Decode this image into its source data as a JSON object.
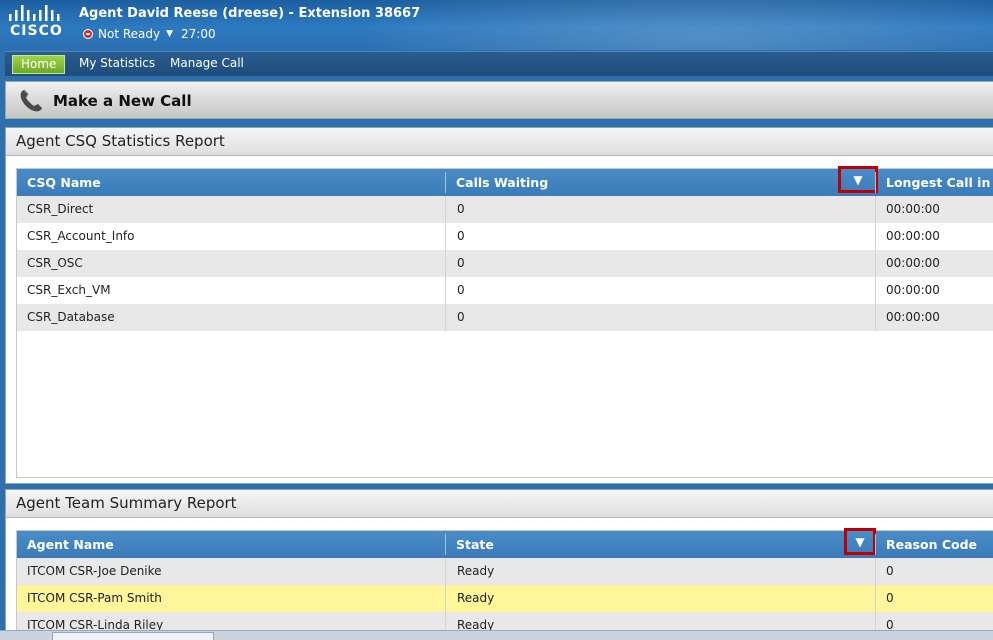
{
  "header": {
    "logo_text": "CISCO",
    "agent_title": "Agent David Reese (dreese) - Extension 38667",
    "status": "Not Ready",
    "timer": "27:00"
  },
  "nav": {
    "items": [
      "Home",
      "My Statistics",
      "Manage Call"
    ],
    "active": "Home"
  },
  "make_call": {
    "label": "Make a New Call"
  },
  "csq_report": {
    "title": "Agent CSQ Statistics Report",
    "columns": [
      "CSQ Name",
      "Calls Waiting",
      "Longest Call in Queue"
    ],
    "sort_glyph": "▼",
    "rows": [
      [
        "CSR_Direct",
        "0",
        "00:00:00"
      ],
      [
        "CSR_Account_Info",
        "0",
        "00:00:00"
      ],
      [
        "CSR_OSC",
        "0",
        "00:00:00"
      ],
      [
        "CSR_Exch_VM",
        "0",
        "00:00:00"
      ],
      [
        "CSR_Database",
        "0",
        "00:00:00"
      ]
    ]
  },
  "team_report": {
    "title": "Agent Team Summary Report",
    "columns": [
      "Agent Name",
      "State",
      "Reason Code"
    ],
    "sort_glyph": "▼",
    "rows": [
      [
        "ITCOM CSR-Joe Denike",
        "Ready",
        "0"
      ],
      [
        "ITCOM CSR-Pam Smith",
        "Ready",
        "0"
      ],
      [
        "ITCOM CSR-Linda Riley",
        "Ready",
        "0"
      ]
    ]
  },
  "colors": {
    "header_blue": "#2d7ac0",
    "grid_header": "#3a7bb8",
    "home_tab": "#7fbf2e",
    "highlight_row": "#fff59a",
    "callout_red": "#c00000"
  }
}
